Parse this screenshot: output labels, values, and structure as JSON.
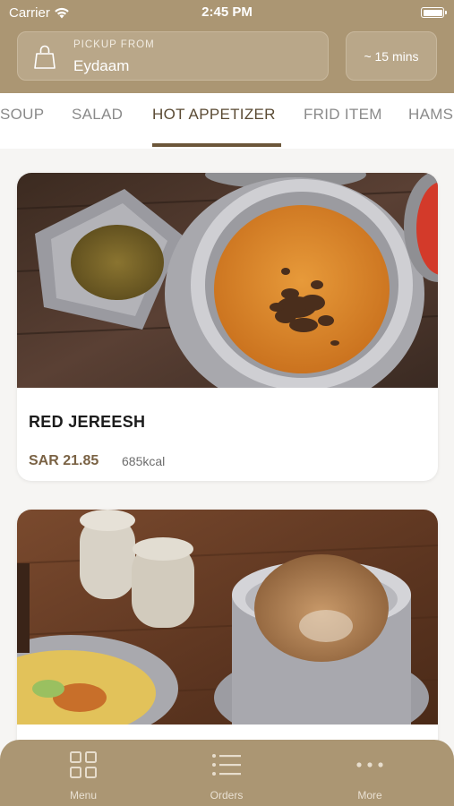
{
  "status_bar": {
    "carrier": "Carrier",
    "time": "2:45 PM"
  },
  "header": {
    "pickup_label": "PICKUP FROM",
    "pickup_location": "Eydaam",
    "eta": "~ 15 mins",
    "accent_color": "#ab9673"
  },
  "category_tabs": [
    {
      "label": "SOUP"
    },
    {
      "label": "SALAD"
    },
    {
      "label": "HOT APPETIZER",
      "selected": true
    },
    {
      "label": "FRID ITEM"
    },
    {
      "label": "HAMS"
    }
  ],
  "menu_items": [
    {
      "name": "RED JEREESH",
      "price": "SAR 21.85",
      "calories": "685kcal",
      "photo": "bowl-of-red-jereesh"
    },
    {
      "name": "",
      "price": "",
      "calories": "",
      "photo": "pot-of-jereesh"
    }
  ],
  "tab_bar": {
    "items": [
      {
        "label": "Menu",
        "icon": "grid-icon"
      },
      {
        "label": "Orders",
        "icon": "list-icon"
      },
      {
        "label": "More",
        "icon": "more-dots-icon"
      }
    ]
  }
}
